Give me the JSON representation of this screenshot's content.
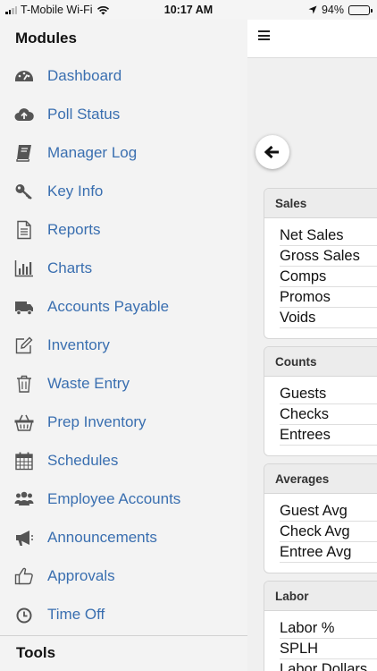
{
  "status_bar": {
    "carrier": "T-Mobile Wi-Fi",
    "time": "10:17 AM",
    "battery": "94%",
    "battery_level": 0.94
  },
  "sidebar": {
    "title": "Modules",
    "items": [
      {
        "label": "Dashboard",
        "icon": "dashboard-icon"
      },
      {
        "label": "Poll Status",
        "icon": "cloud-upload-icon"
      },
      {
        "label": "Manager Log",
        "icon": "book-icon"
      },
      {
        "label": "Key Info",
        "icon": "key-icon"
      },
      {
        "label": "Reports",
        "icon": "document-icon"
      },
      {
        "label": "Charts",
        "icon": "bar-chart-icon"
      },
      {
        "label": "Accounts Payable",
        "icon": "truck-icon"
      },
      {
        "label": "Inventory",
        "icon": "edit-icon"
      },
      {
        "label": "Waste Entry",
        "icon": "trash-icon"
      },
      {
        "label": "Prep Inventory",
        "icon": "basket-icon"
      },
      {
        "label": "Schedules",
        "icon": "calendar-icon"
      },
      {
        "label": "Employee Accounts",
        "icon": "users-icon"
      },
      {
        "label": "Announcements",
        "icon": "megaphone-icon"
      },
      {
        "label": "Approvals",
        "icon": "thumbs-up-icon"
      },
      {
        "label": "Time Off",
        "icon": "clock-icon"
      }
    ],
    "tools_title": "Tools"
  },
  "main": {
    "cards": [
      {
        "title": "Sales",
        "rows": [
          "Net Sales",
          "Gross Sales",
          "Comps",
          "Promos",
          "Voids"
        ]
      },
      {
        "title": "Counts",
        "rows": [
          "Guests",
          "Checks",
          "Entrees"
        ]
      },
      {
        "title": "Averages",
        "rows": [
          "Guest Avg",
          "Check Avg",
          "Entree Avg"
        ]
      },
      {
        "title": "Labor",
        "rows": [
          "Labor %",
          "SPLH",
          "Labor Dollars"
        ]
      }
    ]
  },
  "colors": {
    "link": "#3a6fb0",
    "sidebar_bg": "#f3f3f3",
    "icon": "#555555"
  }
}
